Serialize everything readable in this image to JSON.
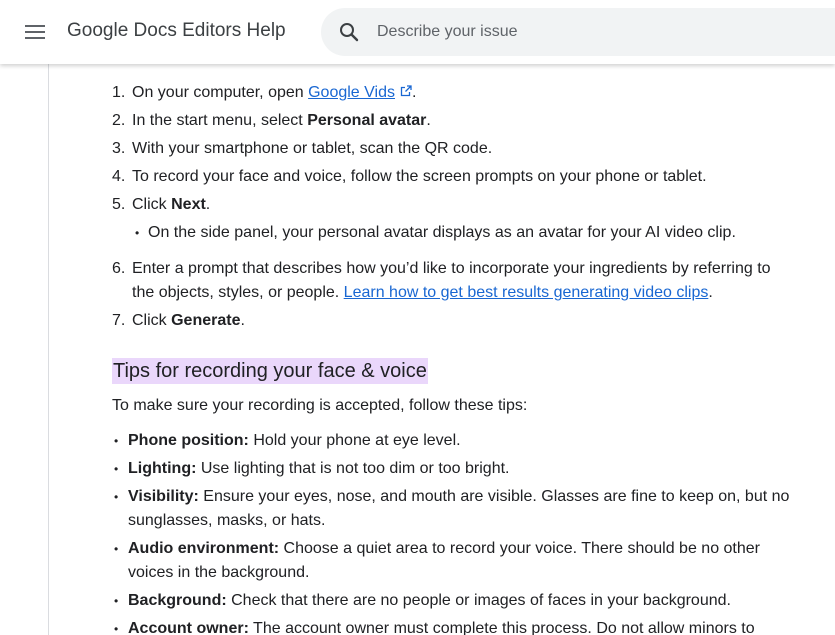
{
  "header": {
    "product_title": "Google Docs Editors Help",
    "search_placeholder": "Describe your issue",
    "menu_icon": "hamburger-menu-icon",
    "search_icon": "search-icon"
  },
  "steps": [
    {
      "num": "1.",
      "pre": "On your computer, open ",
      "link": "Google Vids",
      "post": "."
    },
    {
      "num": "2.",
      "pre": "In the start menu, select ",
      "bold": "Personal avatar",
      "post": "."
    },
    {
      "num": "3.",
      "text": "With your smartphone or tablet, scan the QR code."
    },
    {
      "num": "4.",
      "text": "To record your face and voice, follow the screen prompts on your phone or tablet."
    },
    {
      "num": "5.",
      "pre": "Click ",
      "bold": "Next",
      "post": "."
    },
    {
      "num": "6.",
      "line1": "Enter a prompt that describes how you’d like to incorporate your ingredients by referring to",
      "line2_pre": "the objects, styles, or people. ",
      "link": "Learn how to get best results generating video clips",
      "post": "."
    },
    {
      "num": "7.",
      "pre": "Click ",
      "bold": "Generate",
      "post": "."
    }
  ],
  "step5_sub": "On the side panel, your personal avatar displays as an avatar for your AI video clip.",
  "tips": {
    "heading": "Tips for recording your face & voice",
    "intro": "To make sure your recording is accepted, follow these tips:",
    "items": [
      {
        "label": "Phone position:",
        "text": " Hold your phone at eye level."
      },
      {
        "label": "Lighting:",
        "text": " Use lighting that is not too dim or too bright."
      },
      {
        "label": "Visibility:",
        "text": " Ensure your eyes, nose, and mouth are visible. Glasses are fine to keep on, but no",
        "text2": "sunglasses, masks, or hats."
      },
      {
        "label": "Audio environment:",
        "text": " Choose a quiet area to record your voice. There should be no other",
        "text2": "voices in the background."
      },
      {
        "label": "Background:",
        "text": " Check that there are no people or images of faces in your background."
      },
      {
        "label": "Account owner:",
        "text": " The account owner must complete this process. Do not allow minors to"
      }
    ]
  },
  "colors": {
    "link": "#1967d2",
    "heading_highlight": "#ead7fb",
    "text": "#202124"
  }
}
